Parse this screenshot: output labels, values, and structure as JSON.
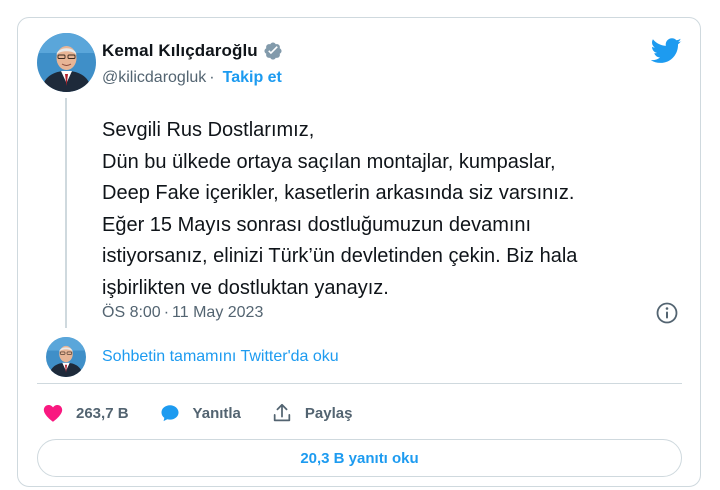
{
  "tweet": {
    "author": {
      "display_name": "Kemal Kılıçdaroğlu",
      "handle": "@kilicdarogluk",
      "separator": "·",
      "follow_label": "Takip et",
      "verified": true
    },
    "text_lines": [
      "Sevgili Rus Dostlarımız,",
      "Dün bu ülkede ortaya saçılan montajlar, kumpaslar,",
      "Deep Fake içerikler, kasetlerin arkasında siz varsınız.",
      "Eğer 15 Mayıs sonrası dostluğumuzun devamını",
      "istiyorsanız, elinizi Türk’ün devletinden çekin. Biz hala",
      "işbirlikten ve dostluktan yanayız."
    ],
    "time": "ÖS 8:00",
    "meta_separator": "·",
    "date": "11 May 2023",
    "conversation_link": "Sohbetin tamamını Twitter'da oku",
    "actions": {
      "likes": "263,7 B",
      "reply_label": "Yanıtla",
      "share_label": "Paylaş"
    },
    "read_replies_label": "20,3 B yanıtı oku"
  },
  "icons": {
    "brand": "twitter-bird-icon",
    "verified": "verified-badge-icon",
    "info": "info-icon",
    "like": "heart-icon",
    "reply": "speech-bubble-icon",
    "share": "share-upload-icon"
  },
  "colors": {
    "accent": "#1d9bf0",
    "like": "#f91880",
    "text": "#0f1419",
    "secondary": "#536471",
    "border": "#cfd9de"
  }
}
